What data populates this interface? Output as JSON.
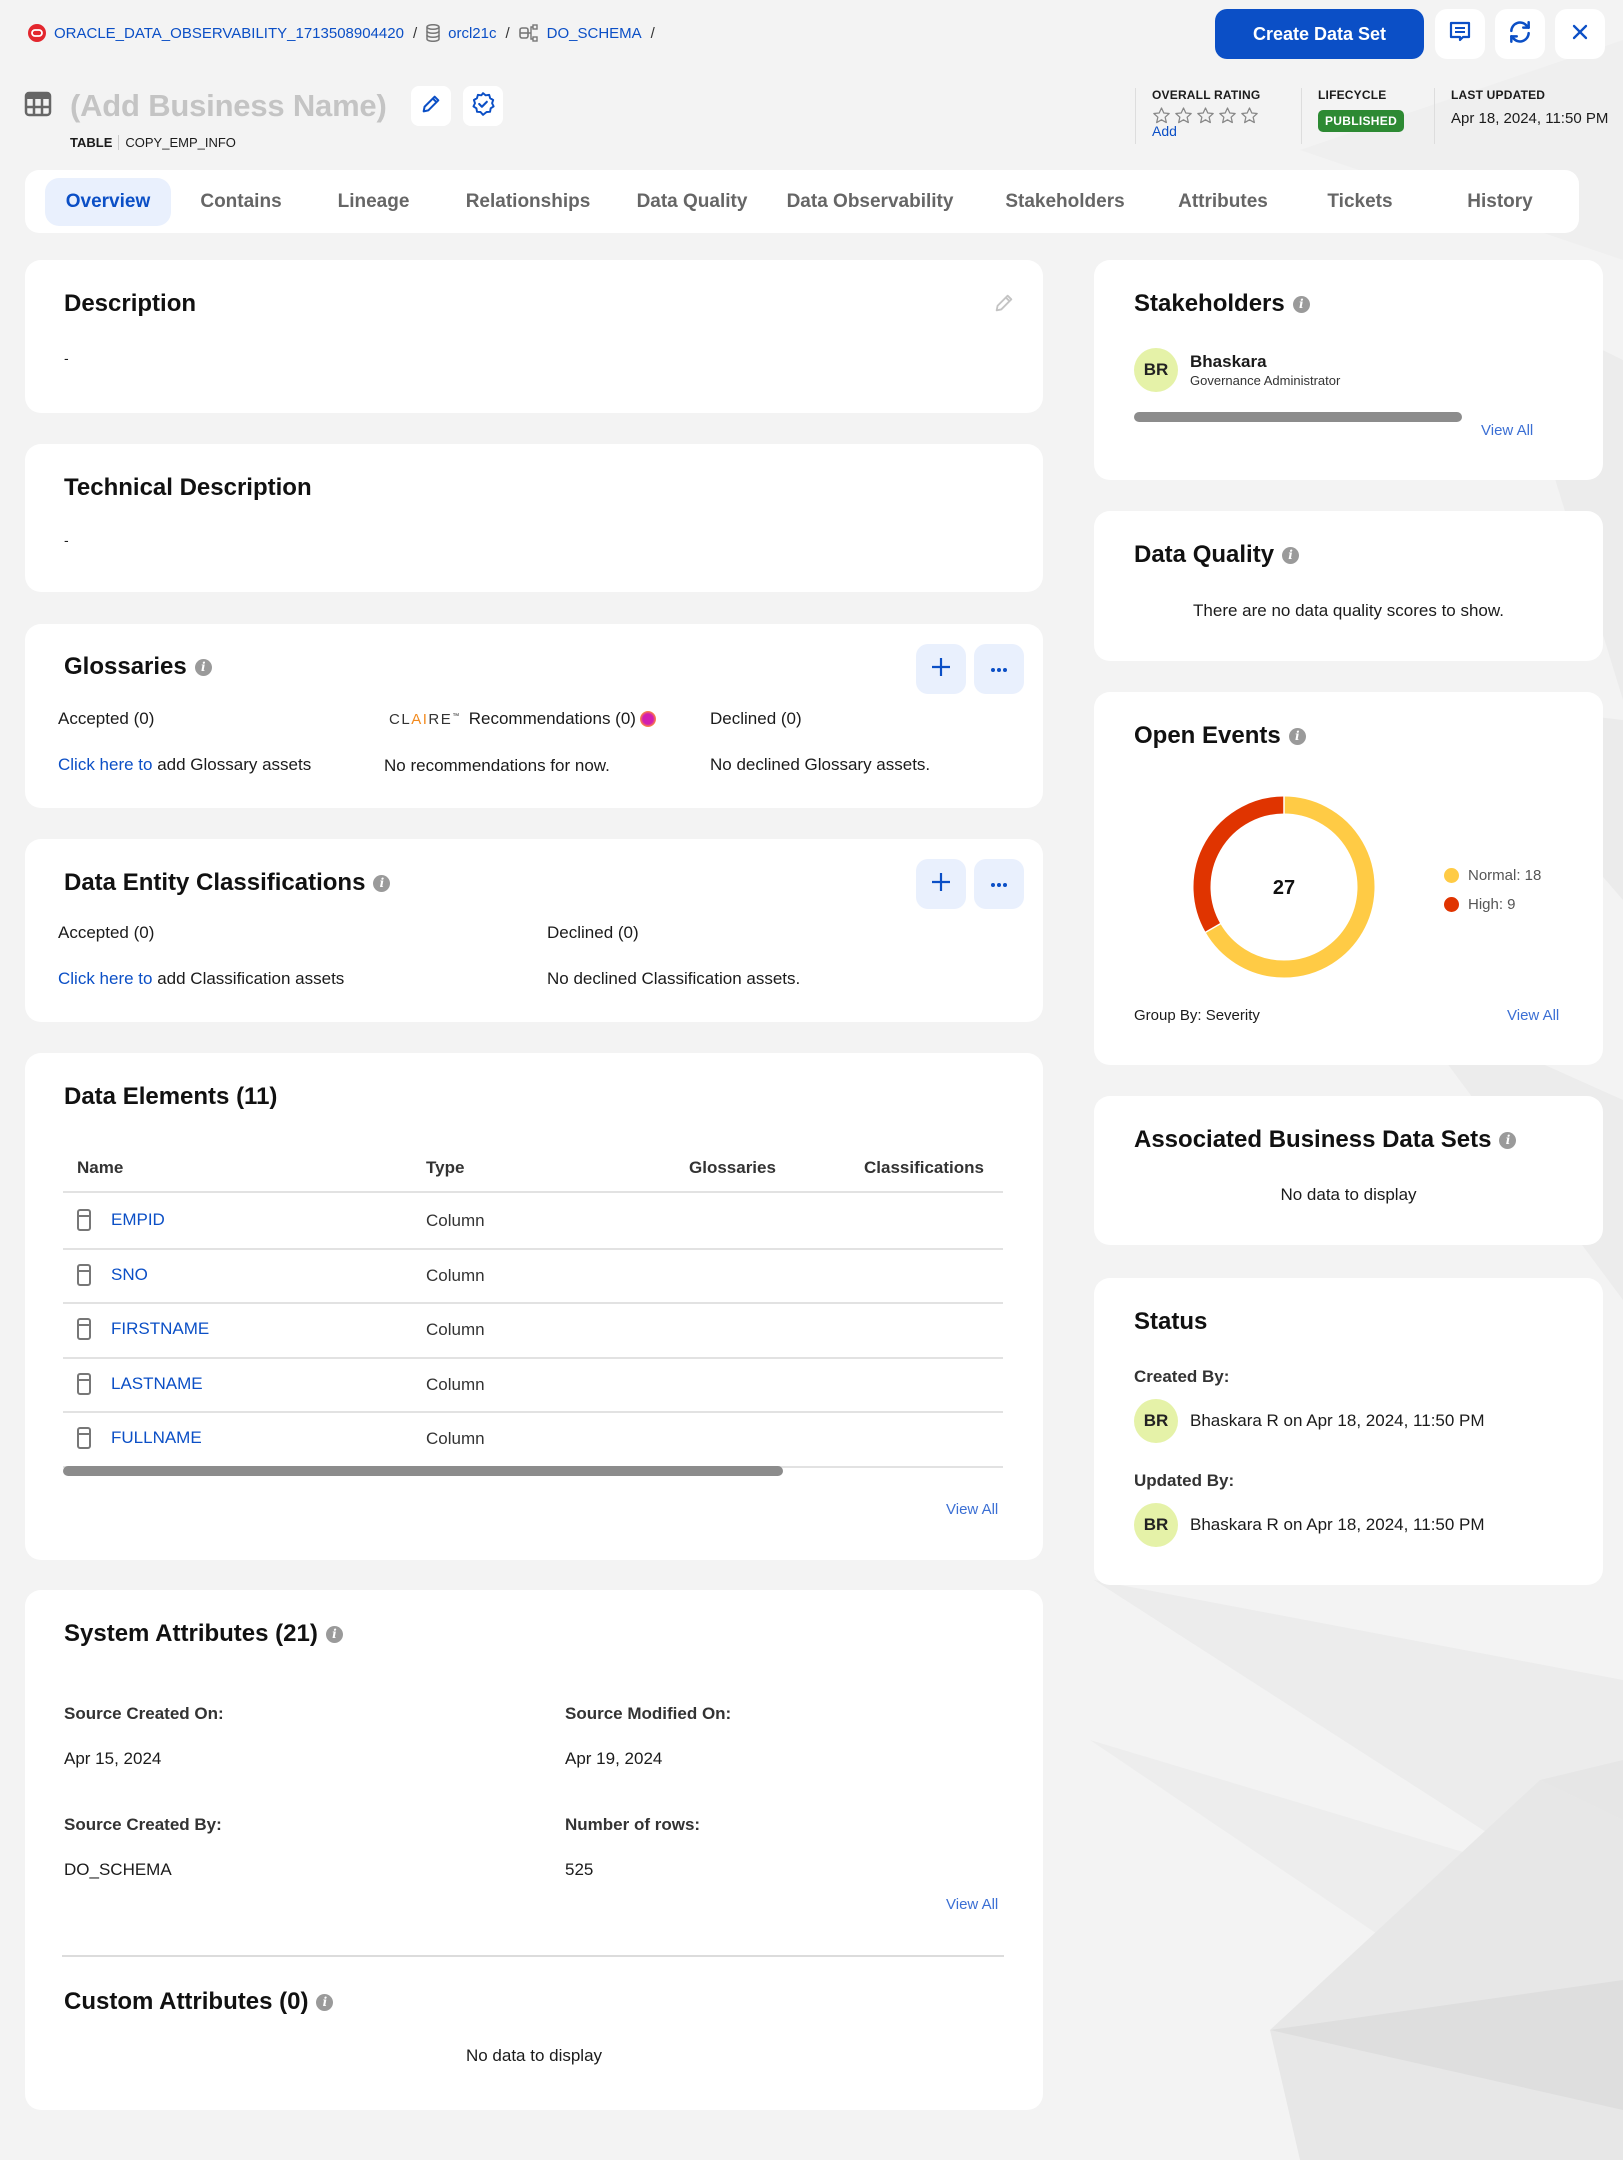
{
  "breadcrumb": [
    {
      "label": "ORACLE_DATA_OBSERVABILITY_1713508904420",
      "icon": "oracle-logo-icon"
    },
    {
      "label": "orcl21c",
      "icon": "database-icon"
    },
    {
      "label": "DO_SCHEMA",
      "icon": "schema-icon"
    }
  ],
  "header": {
    "create_button": "Create Data Set",
    "comment_icon": "comment-icon",
    "refresh_icon": "refresh-icon",
    "close_icon": "close-icon",
    "title": "(Add Business Name)",
    "asset_type": "TABLE",
    "asset_name": "COPY_EMP_INFO",
    "overall_rating_label": "OVERALL RATING",
    "rating_stars_filled": 0,
    "rating_stars_total": 5,
    "rating_add": "Add",
    "lifecycle_label": "LIFECYCLE",
    "lifecycle_value": "PUBLISHED",
    "last_updated_label": "LAST UPDATED",
    "last_updated_value": "Apr 18, 2024, 11:50 PM"
  },
  "tabs": [
    {
      "label": "Overview",
      "active": true
    },
    {
      "label": "Contains"
    },
    {
      "label": "Lineage"
    },
    {
      "label": "Relationships"
    },
    {
      "label": "Data Quality"
    },
    {
      "label": "Data Observability"
    },
    {
      "label": "Stakeholders"
    },
    {
      "label": "Attributes"
    },
    {
      "label": "Tickets"
    },
    {
      "label": "History"
    }
  ],
  "description": {
    "title": "Description",
    "value": "-"
  },
  "technical_description": {
    "title": "Technical Description",
    "value": "-"
  },
  "glossaries": {
    "title": "Glossaries",
    "accepted_label": "Accepted (0)",
    "claire_brand": "CLAIRE",
    "recommendations_label": "Recommendations (0)",
    "declined_label": "Declined (0)",
    "click_here": "Click here to",
    "add_text": " add Glossary assets",
    "no_recommendations": "No recommendations for now.",
    "no_declined": "No declined Glossary assets."
  },
  "classifications": {
    "title": "Data Entity Classifications",
    "accepted_label": "Accepted (0)",
    "declined_label": "Declined (0)",
    "click_here": "Click here to",
    "add_text": " add Classification assets",
    "no_declined": "No declined Classification assets."
  },
  "data_elements": {
    "title": "Data Elements (11)",
    "columns": [
      "Name",
      "Type",
      "Glossaries",
      "Classifications"
    ],
    "rows": [
      {
        "name": "EMPID",
        "type": "Column",
        "glossaries": "",
        "classifications": ""
      },
      {
        "name": "SNO",
        "type": "Column",
        "glossaries": "",
        "classifications": ""
      },
      {
        "name": "FIRSTNAME",
        "type": "Column",
        "glossaries": "",
        "classifications": ""
      },
      {
        "name": "LASTNAME",
        "type": "Column",
        "glossaries": "",
        "classifications": ""
      },
      {
        "name": "FULLNAME",
        "type": "Column",
        "glossaries": "",
        "classifications": ""
      }
    ],
    "view_all": "View All"
  },
  "system_attributes": {
    "title": "System Attributes (21)",
    "items": [
      {
        "label": "Source Created On:",
        "value": "Apr 15, 2024"
      },
      {
        "label": "Source Modified On:",
        "value": "Apr 19, 2024"
      },
      {
        "label": "Source Created By:",
        "value": "DO_SCHEMA"
      },
      {
        "label": "Number of rows:",
        "value": "525"
      }
    ],
    "view_all": "View All"
  },
  "custom_attributes": {
    "title": "Custom Attributes (0)",
    "empty": "No data to display"
  },
  "stakeholders": {
    "title": "Stakeholders",
    "people": [
      {
        "initials": "BR",
        "name": "Bhaskara",
        "role": "Governance Administrator"
      }
    ],
    "view_all": "View All"
  },
  "data_quality": {
    "title": "Data Quality",
    "empty": "There are no data quality scores to show."
  },
  "open_events": {
    "title": "Open Events",
    "total": "27",
    "group_by": "Group By: Severity",
    "view_all": "View All"
  },
  "chart_data": {
    "type": "pie",
    "title": "Open Events",
    "center_label": "27",
    "categories": [
      "Normal",
      "High"
    ],
    "values": [
      18,
      9
    ],
    "colors": [
      "#ffcb45",
      "#e03400"
    ],
    "legend": "right",
    "legend_labels": [
      "Normal: 18",
      "High: 9"
    ]
  },
  "associated_bds": {
    "title": "Associated Business Data Sets",
    "empty": "No data to display"
  },
  "status": {
    "title": "Status",
    "created_label": "Created By:",
    "created_initials": "BR",
    "created_name": "Bhaskara R",
    "created_on": " on Apr 18, 2024, 11:50 PM",
    "updated_label": "Updated By:",
    "updated_initials": "BR",
    "updated_name": "Bhaskara R",
    "updated_on": " on Apr 18, 2024, 11:50 PM"
  },
  "colors": {
    "accent": "#0b4fc6",
    "published": "#2d8a33",
    "normal": "#ffcb45",
    "high": "#e03400"
  }
}
